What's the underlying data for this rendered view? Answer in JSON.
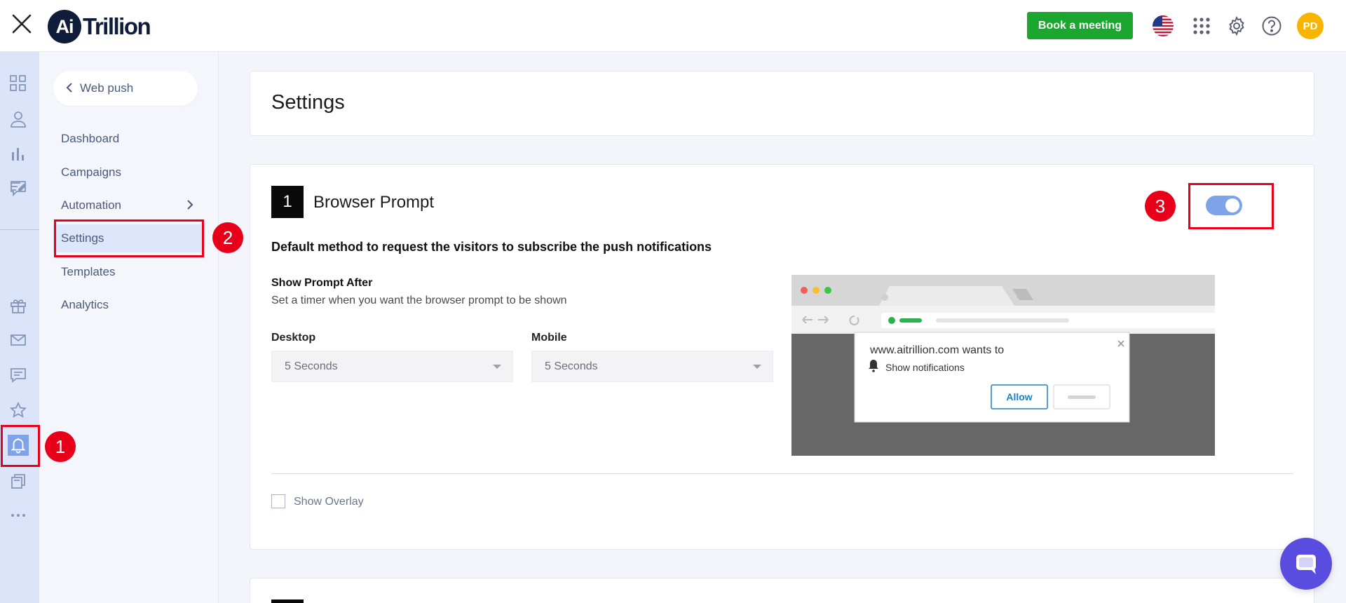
{
  "brand": {
    "logo_mark": "Ai",
    "logo_text": "Trillion"
  },
  "topbar": {
    "book_meeting_label": "Book a meeting",
    "avatar_initials": "PD",
    "icons": [
      "close-icon",
      "us-flag-icon",
      "apps-grid-icon",
      "gear-icon",
      "help-icon"
    ]
  },
  "rail": {
    "icons": [
      "dashboard-grid-icon",
      "user-icon",
      "bar-chart-icon",
      "edit-note-icon",
      "gift-icon",
      "mail-icon",
      "chat-icon",
      "star-icon",
      "bell-icon",
      "copy-icon",
      "more-icon"
    ],
    "active": "bell-icon"
  },
  "subnav": {
    "back_label": "Web push",
    "items": [
      {
        "label": "Dashboard"
      },
      {
        "label": "Campaigns"
      },
      {
        "label": "Automation"
      },
      {
        "label": "Settings"
      },
      {
        "label": "Templates"
      },
      {
        "label": "Analytics"
      }
    ],
    "active": "Settings"
  },
  "page": {
    "title": "Settings"
  },
  "browser_prompt": {
    "step": "1",
    "title": "Browser Prompt",
    "enabled": true,
    "description": "Default method to request the visitors to subscribe the push notifications",
    "show_after_label": "Show Prompt After",
    "show_after_desc": "Set a timer when you want the browser prompt to be shown",
    "desktop_label": "Desktop",
    "desktop_value": "5 Seconds",
    "mobile_label": "Mobile",
    "mobile_value": "5 Seconds",
    "preview": {
      "site_text": "www.aitrillion.com wants to",
      "notif_text": "Show notifications",
      "allow_label": "Allow"
    },
    "overlay_label": "Show Overlay",
    "overlay_checked": false
  },
  "annotations": [
    "1",
    "2",
    "3"
  ],
  "colors": {
    "accent_green": "#1aa62f",
    "toggle_on": "#7fa3e8",
    "annotation_red": "#e8001a",
    "chat_purple": "#5b4ce0"
  }
}
